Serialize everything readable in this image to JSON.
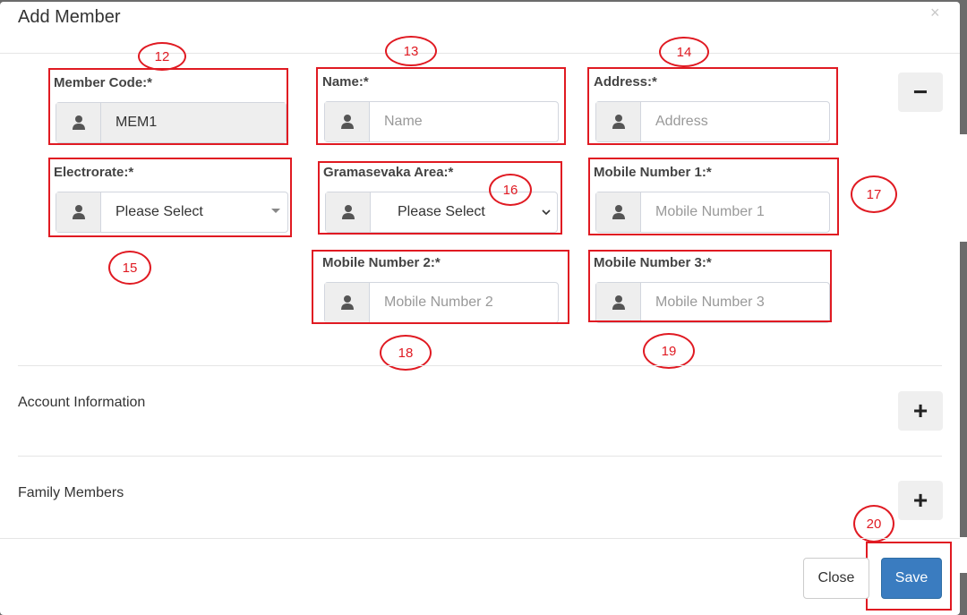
{
  "dialog": {
    "title": "Add Member",
    "close_glyph": "×"
  },
  "fields": {
    "member_code": {
      "label": "Member Code:*",
      "value": "MEM1"
    },
    "name": {
      "label": "Name:*",
      "placeholder": "Name"
    },
    "address": {
      "label": "Address:*",
      "placeholder": "Address"
    },
    "electorate": {
      "label": "Electrorate:*",
      "value": "Please Select"
    },
    "gramasevaka": {
      "label": "Gramasevaka Area:*",
      "value": "Please Select"
    },
    "mobile1": {
      "label": "Mobile Number 1:*",
      "placeholder": "Mobile Number 1"
    },
    "mobile2": {
      "label": "Mobile Number 2:*",
      "placeholder": "Mobile Number 2"
    },
    "mobile3": {
      "label": "Mobile Number 3:*",
      "placeholder": "Mobile Number 3"
    }
  },
  "sections": {
    "account": {
      "label": "Account Information",
      "toggle": "+"
    },
    "family": {
      "label": "Family Members",
      "toggle": "+"
    },
    "collapse": "−"
  },
  "annotations": {
    "n12": "12",
    "n13": "13",
    "n14": "14",
    "n15": "15",
    "n16": "16",
    "n17": "17",
    "n18": "18",
    "n19": "19",
    "n20": "20"
  },
  "footer": {
    "close_label": "Close",
    "save_label": "Save"
  },
  "icons": [
    "user-icon",
    "caret-down-icon",
    "chevron-down-icon",
    "close-icon",
    "minus-icon",
    "plus-icon"
  ],
  "colors": {
    "annotation_red": "#e01a22",
    "primary": "#3a7cc0"
  }
}
